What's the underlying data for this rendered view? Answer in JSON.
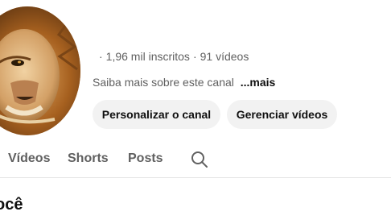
{
  "channel": {
    "name": "",
    "handle": "",
    "subscribers": "1,96 mil inscritos",
    "video_count": "91 vídeos",
    "separator": "·",
    "description": "Saiba mais sobre este canal",
    "more_label": "...mais"
  },
  "actions": {
    "customize_label": "Personalizar o canal",
    "manage_label": "Gerenciar vídeos"
  },
  "tabs": [
    {
      "label": "Vídeos"
    },
    {
      "label": "Shorts"
    },
    {
      "label": "Posts"
    }
  ],
  "section": {
    "title": "ocê"
  },
  "colors": {
    "button_bg": "#f2f2f2",
    "secondary_text": "#606060",
    "divider": "#e5e5e5"
  },
  "icons": {
    "search": "search-icon",
    "avatar": "lion-avatar"
  }
}
